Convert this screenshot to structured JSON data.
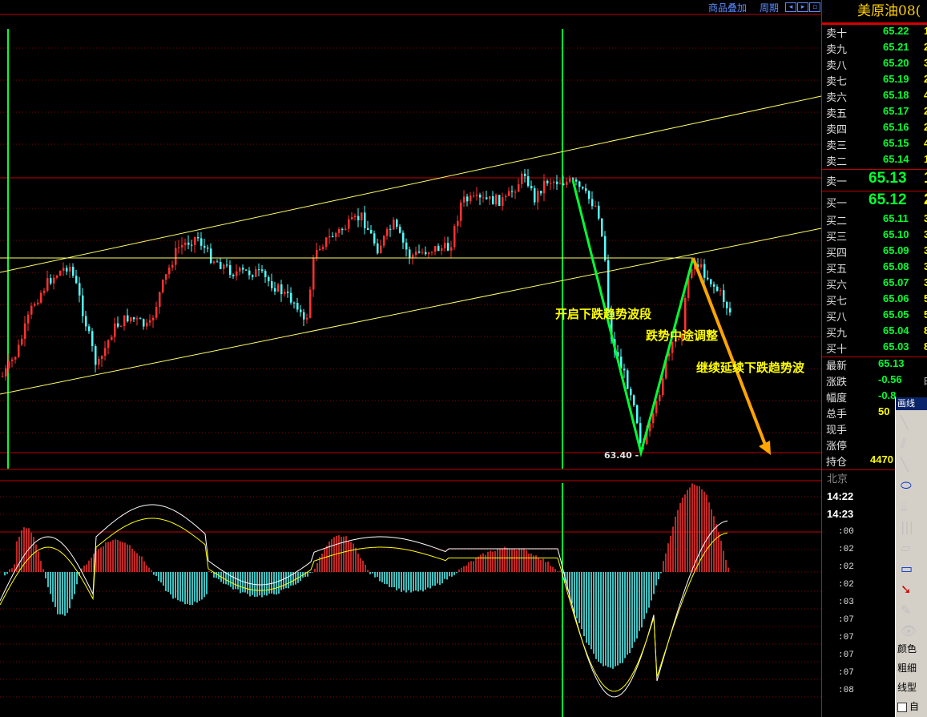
{
  "toolbar": {
    "overlay_label": "商品叠加",
    "period_label": "周期"
  },
  "side": {
    "title": "美原油08(",
    "asks": [
      {
        "label": "卖十",
        "price": "65.22",
        "vol": "1"
      },
      {
        "label": "卖九",
        "price": "65.21",
        "vol": "2"
      },
      {
        "label": "卖八",
        "price": "65.20",
        "vol": "3"
      },
      {
        "label": "卖七",
        "price": "65.19",
        "vol": "2"
      },
      {
        "label": "卖六",
        "price": "65.18",
        "vol": "4"
      },
      {
        "label": "卖五",
        "price": "65.17",
        "vol": "2"
      },
      {
        "label": "卖四",
        "price": "65.16",
        "vol": "2"
      },
      {
        "label": "卖三",
        "price": "65.15",
        "vol": "4"
      },
      {
        "label": "卖二",
        "price": "65.14",
        "vol": "1"
      }
    ],
    "ask1": {
      "label": "卖一",
      "price": "65.13",
      "vol": "1"
    },
    "bid1": {
      "label": "买一",
      "price": "65.12",
      "vol": "2"
    },
    "bids": [
      {
        "label": "买二",
        "price": "65.11",
        "vol": "3"
      },
      {
        "label": "买三",
        "price": "65.10",
        "vol": "3"
      },
      {
        "label": "买四",
        "price": "65.09",
        "vol": "3"
      },
      {
        "label": "买五",
        "price": "65.08",
        "vol": "3"
      },
      {
        "label": "买六",
        "price": "65.07",
        "vol": "3"
      },
      {
        "label": "买七",
        "price": "65.06",
        "vol": "5"
      },
      {
        "label": "买八",
        "price": "65.05",
        "vol": "5"
      },
      {
        "label": "买九",
        "price": "65.04",
        "vol": "8"
      },
      {
        "label": "买十",
        "price": "65.03",
        "vol": "8"
      }
    ],
    "stats": [
      {
        "label": "最新",
        "value": "65.13",
        "extra": "",
        "color": "#00ff33"
      },
      {
        "label": "涨跌",
        "value": "-0.56",
        "extra": "时",
        "color": "#00ff33"
      },
      {
        "label": "幅度",
        "value": "-0.8",
        "extra": "",
        "color": "#00ff33"
      },
      {
        "label": "总手",
        "value": "50",
        "extra": "",
        "color": "#ffff00"
      },
      {
        "label": "现手",
        "value": "",
        "extra": "",
        "color": "#ffff00"
      },
      {
        "label": "涨停",
        "value": "",
        "extra": "",
        "color": "#ffff00"
      },
      {
        "label": "持仓",
        "value": "4470",
        "extra": "",
        "color": "#ffff00"
      }
    ],
    "region": "北京",
    "times": [
      "14:22",
      "14:23"
    ],
    "ticks": [
      ":00",
      ":02",
      ":02",
      ":02",
      ":03",
      ":07",
      ":07",
      ":07",
      ":07",
      ":08"
    ]
  },
  "drawing": {
    "title": "画线",
    "color_label": "颜色",
    "width_label": "粗细",
    "line_label": "线型",
    "auto_label": "自"
  },
  "annotations": {
    "low_label": "63.40",
    "label_start": "开启下跌趋势波段",
    "label_mid": "跌势中途调整",
    "label_cont": "继续延续下跌趋势波"
  },
  "colors": {
    "up": "#ff3232",
    "down": "#54ffff",
    "trend": "#ffff66",
    "wave": "#00ff33",
    "arrow": "#ffa500",
    "grid": "#8b0000",
    "dif": "#ffffff",
    "dea": "#ffff00"
  },
  "chart_data": {
    "type": "candlestick",
    "low_marker": 63.4,
    "price_levels": [
      65.22,
      65.21,
      65.2,
      65.19,
      65.18,
      65.17,
      65.16,
      65.15,
      65.14,
      65.13,
      65.12,
      65.11,
      65.1,
      65.09,
      65.08,
      65.07,
      65.06,
      65.05,
      65.04,
      65.03
    ]
  }
}
